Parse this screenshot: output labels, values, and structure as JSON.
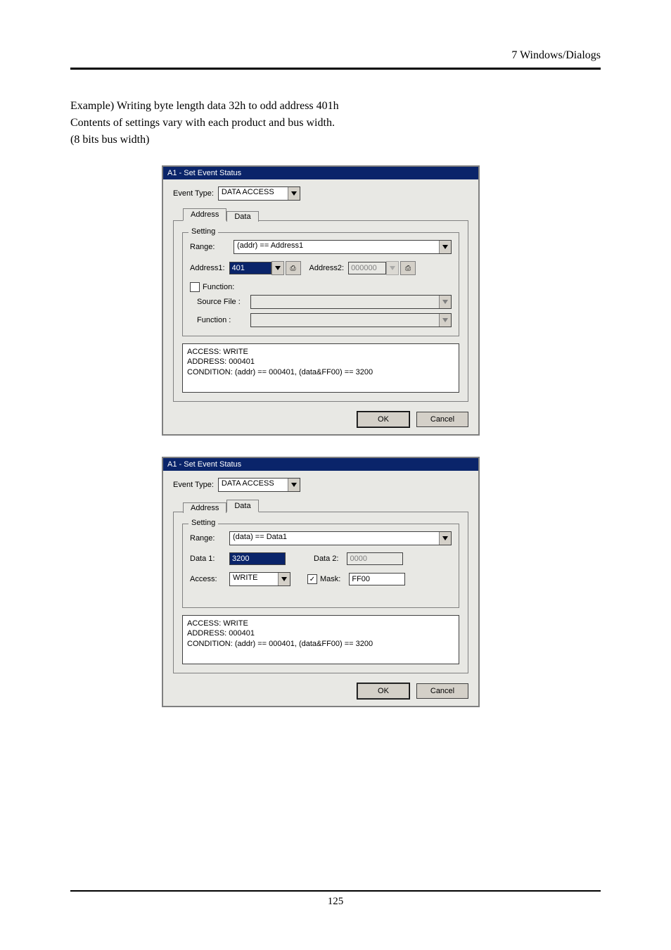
{
  "header": {
    "section": "7  Windows/Dialogs"
  },
  "intro": {
    "line1": "Example) Writing byte length data 32h to odd address 401h",
    "line2": "Contents of settings vary with each product and bus width.",
    "line3": "(8 bits bus width)"
  },
  "dialog1": {
    "title": "A1 - Set Event Status",
    "event_type_label": "Event Type:",
    "event_type_value": "DATA ACCESS",
    "tabs": {
      "address": "Address",
      "data": "Data"
    },
    "group_legend": "Setting",
    "range_label": "Range:",
    "range_value": "(addr) == Address1",
    "addr1_label": "Address1:",
    "addr1_value": "401",
    "addr2_label": "Address2:",
    "addr2_value": "000000",
    "function_chk": "Function:",
    "src_label": "Source File :",
    "func_label": "Function :",
    "status_l1": "ACCESS: WRITE",
    "status_l2": "ADDRESS: 000401",
    "status_l3": "CONDITION: (addr) == 000401, (data&FF00) == 3200",
    "ok": "OK",
    "cancel": "Cancel"
  },
  "dialog2": {
    "title": "A1 - Set Event Status",
    "event_type_label": "Event Type:",
    "event_type_value": "DATA ACCESS",
    "tabs": {
      "address": "Address",
      "data": "Data"
    },
    "group_legend": "Setting",
    "range_label": "Range:",
    "range_value": "(data) == Data1",
    "data1_label": "Data 1:",
    "data1_value": "3200",
    "data2_label": "Data 2:",
    "data2_value": "0000",
    "access_label": "Access:",
    "access_value": "WRITE",
    "mask_label": "Mask:",
    "mask_value": "FF00",
    "status_l1": "ACCESS: WRITE",
    "status_l2": "ADDRESS: 000401",
    "status_l3": "CONDITION: (addr) == 000401, (data&FF00) == 3200",
    "ok": "OK",
    "cancel": "Cancel"
  },
  "footer": {
    "page": "125"
  }
}
